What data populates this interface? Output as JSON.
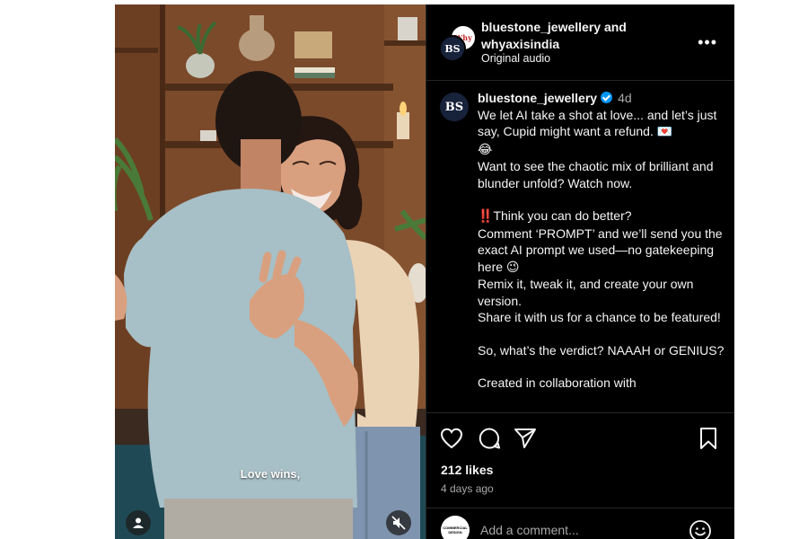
{
  "post": {
    "header": {
      "user1": "bluestone_jewellery",
      "joiner": "and",
      "user2": "whyaxisindia",
      "audio": "Original audio",
      "avatar_back_text": "Why",
      "avatar_front_text": "BS"
    },
    "caption": {
      "avatar_text": "BS",
      "username": "bluestone_jewellery",
      "time": "4d",
      "line1": "We let AI take a shot at love... and let’s just say, Cupid might want a refund. ",
      "line1_emoji": "💌",
      "line1_emoji2": "😂",
      "line2": "Want to see the chaotic mix of brilliant and blunder unfold? Watch now.",
      "line3_emoji": "‼️",
      "line3": "Think you can do better?",
      "line4": "Comment ‘PROMPT’ and we’ll send you the exact AI prompt we used—no gatekeeping here ",
      "line4_emoji": "😉",
      "line5": "Remix it, tweak it, and create your own version.",
      "line6": "Share it with us for a chance to be featured!",
      "line7": "So, what’s the verdict? NAAAH or GENIUS?",
      "line8": "Created in collaboration with"
    },
    "video": {
      "subtitle": "Love wins,"
    },
    "likes": "212 likes",
    "time_ago": "4 days ago",
    "comment": {
      "placeholder": "Add a comment...",
      "avatar_text": "COMMERCIAL DESIGN"
    }
  },
  "icons": {
    "like": "heart-icon",
    "comment": "comment-icon",
    "share": "send-icon",
    "save": "bookmark-icon",
    "more": "more-icon",
    "emoji": "emoji-icon",
    "tag": "user-tag-icon",
    "mute": "speaker-muted-icon"
  },
  "colors": {
    "background": "#000000",
    "text": "#f5f5f5",
    "secondary": "#a8a8a8",
    "verified": "#0095f6",
    "divider": "#262626"
  }
}
